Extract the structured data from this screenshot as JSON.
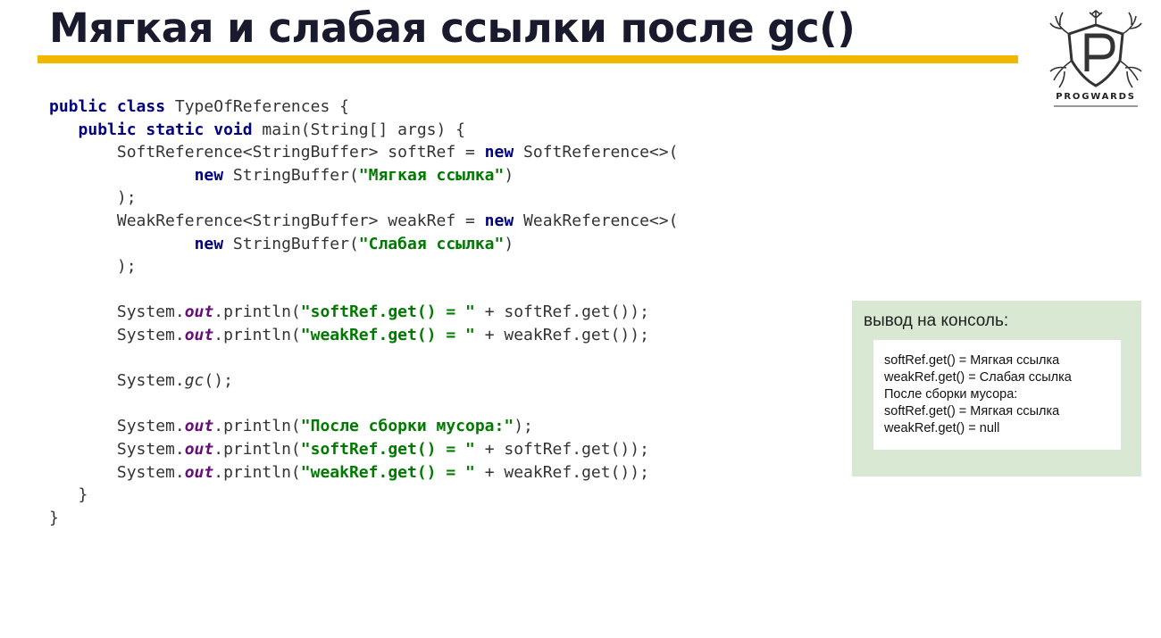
{
  "slide": {
    "title": "Мягкая и слабая ссылки после gc()",
    "accent_color": "#f0b800"
  },
  "logo": {
    "icon": "progwards-crest-icon",
    "name": "PROGWARDS"
  },
  "code": {
    "lines": [
      [
        {
          "t": "public class",
          "c": "kw"
        },
        {
          "t": " TypeOfReferences {"
        }
      ],
      [
        {
          "t": "   "
        },
        {
          "t": "public static void",
          "c": "kw"
        },
        {
          "t": " main(String[] args) {"
        }
      ],
      [
        {
          "t": "       SoftReference<StringBuffer> softRef = "
        },
        {
          "t": "new",
          "c": "kw"
        },
        {
          "t": " SoftReference<>("
        }
      ],
      [
        {
          "t": "               "
        },
        {
          "t": "new",
          "c": "kw"
        },
        {
          "t": " StringBuffer("
        },
        {
          "t": "\"Мягкая ссылка\"",
          "c": "str"
        },
        {
          "t": ")"
        }
      ],
      [
        {
          "t": "       );"
        }
      ],
      [
        {
          "t": "       WeakReference<StringBuffer> weakRef = "
        },
        {
          "t": "new",
          "c": "kw"
        },
        {
          "t": " WeakReference<>("
        }
      ],
      [
        {
          "t": "               "
        },
        {
          "t": "new",
          "c": "kw"
        },
        {
          "t": " StringBuffer("
        },
        {
          "t": "\"Слабая ссылка\"",
          "c": "str"
        },
        {
          "t": ")"
        }
      ],
      [
        {
          "t": "       );"
        }
      ],
      [
        {
          "t": ""
        }
      ],
      [
        {
          "t": "       System."
        },
        {
          "t": "out",
          "c": "fld"
        },
        {
          "t": ".println("
        },
        {
          "t": "\"softRef.get() = \"",
          "c": "str"
        },
        {
          "t": " + softRef.get());"
        }
      ],
      [
        {
          "t": "       System."
        },
        {
          "t": "out",
          "c": "fld"
        },
        {
          "t": ".println("
        },
        {
          "t": "\"weakRef.get() = \"",
          "c": "str"
        },
        {
          "t": " + weakRef.get());"
        }
      ],
      [
        {
          "t": ""
        }
      ],
      [
        {
          "t": "       System."
        },
        {
          "t": "gc",
          "c": "it"
        },
        {
          "t": "();"
        }
      ],
      [
        {
          "t": ""
        }
      ],
      [
        {
          "t": "       System."
        },
        {
          "t": "out",
          "c": "fld"
        },
        {
          "t": ".println("
        },
        {
          "t": "\"После сборки мусора:\"",
          "c": "str"
        },
        {
          "t": ");"
        }
      ],
      [
        {
          "t": "       System."
        },
        {
          "t": "out",
          "c": "fld"
        },
        {
          "t": ".println("
        },
        {
          "t": "\"softRef.get() = \"",
          "c": "str"
        },
        {
          "t": " + softRef.get());"
        }
      ],
      [
        {
          "t": "       System."
        },
        {
          "t": "out",
          "c": "fld"
        },
        {
          "t": ".println("
        },
        {
          "t": "\"weakRef.get() = \"",
          "c": "str"
        },
        {
          "t": " + weakRef.get());"
        }
      ],
      [
        {
          "t": "   }"
        }
      ],
      [
        {
          "t": "}"
        }
      ]
    ]
  },
  "console": {
    "title": "вывод на консоль:",
    "lines": [
      "softRef.get() = Мягкая ссылка",
      "weakRef.get() = Слабая ссылка",
      "После сборки мусора:",
      "softRef.get() = Мягкая ссылка",
      "weakRef.get() = null"
    ]
  }
}
